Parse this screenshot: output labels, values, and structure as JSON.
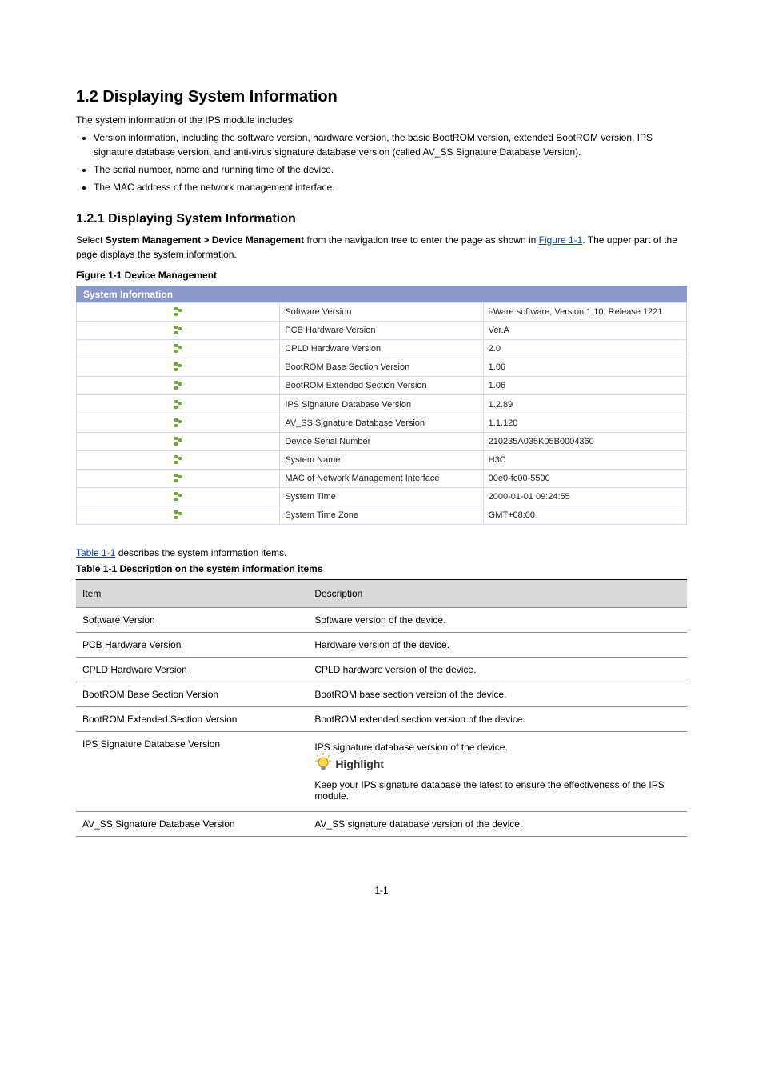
{
  "pageNumber": "1-1",
  "section1": {
    "heading": "1.2  Displaying System Information",
    "intro": "The system information of the IPS module includes:",
    "bullets": [
      "Version information, including the software version, hardware version, the basic BootROM version, extended BootROM version, IPS signature database version, and anti-virus signature database version (called AV_SS Signature Database Version).",
      "The serial number, name and running time of the device.",
      "The MAC address of the network management interface."
    ]
  },
  "section1_1": {
    "heading": "1.2.1  Displaying System Information",
    "navText1": "Select ",
    "navBold": "System Management > Device Management",
    "navText2": " from the navigation tree to enter the page as shown in ",
    "navLinkText": "Figure 1-1",
    "navText3": ". The upper part of the page displays the system information.",
    "figCaption": "Figure 1-1 Device Management"
  },
  "sysinfo": {
    "header": "System Information",
    "rows": [
      {
        "label": "Software Version",
        "value": "i-Ware software, Version 1.10, Release 1221"
      },
      {
        "label": "PCB Hardware Version",
        "value": "Ver.A"
      },
      {
        "label": "CPLD Hardware Version",
        "value": "2.0"
      },
      {
        "label": "BootROM Base Section Version",
        "value": "1.06"
      },
      {
        "label": "BootROM Extended Section Version",
        "value": "1.06"
      },
      {
        "label": "IPS Signature Database Version",
        "value": "1.2.89"
      },
      {
        "label": "AV_SS Signature Database Version",
        "value": "1.1.120"
      },
      {
        "label": "Device Serial Number",
        "value": "210235A035K05B0004360"
      },
      {
        "label": "System Name",
        "value": "H3C"
      },
      {
        "label": "MAC of Network Management Interface",
        "value": "00e0-fc00-5500"
      },
      {
        "label": "System Time",
        "value": "2000-01-01 09:24:55"
      },
      {
        "label": "System Time Zone",
        "value": "GMT+08:00"
      }
    ]
  },
  "descIntroLink": "Table 1-1",
  "descIntroRest": " describes the system information items.",
  "descCaption": "Table 1-1 Description on the system information items",
  "descTable": {
    "headItem": "Item",
    "headDesc": "Description",
    "rows": [
      {
        "item": "Software Version",
        "desc": "Software version of the device."
      },
      {
        "item": "PCB Hardware Version",
        "desc": "Hardware version of the device."
      },
      {
        "item": "CPLD Hardware Version",
        "desc": "CPLD hardware version of the device."
      },
      {
        "item": "BootROM Base Section Version",
        "desc": "BootROM base section version of the device."
      },
      {
        "item": "BootROM Extended Section Version",
        "desc": "BootROM extended section version of the device."
      },
      {
        "item": "IPS Signature Database Version",
        "highlightTitle": " Highlight",
        "desc": "IPS signature database version of the device.",
        "extra": "Keep your IPS signature database the latest to ensure the effectiveness of the IPS module."
      },
      {
        "item": "AV_SS Signature Database Version",
        "desc": "AV_SS signature database version of the device."
      }
    ]
  }
}
